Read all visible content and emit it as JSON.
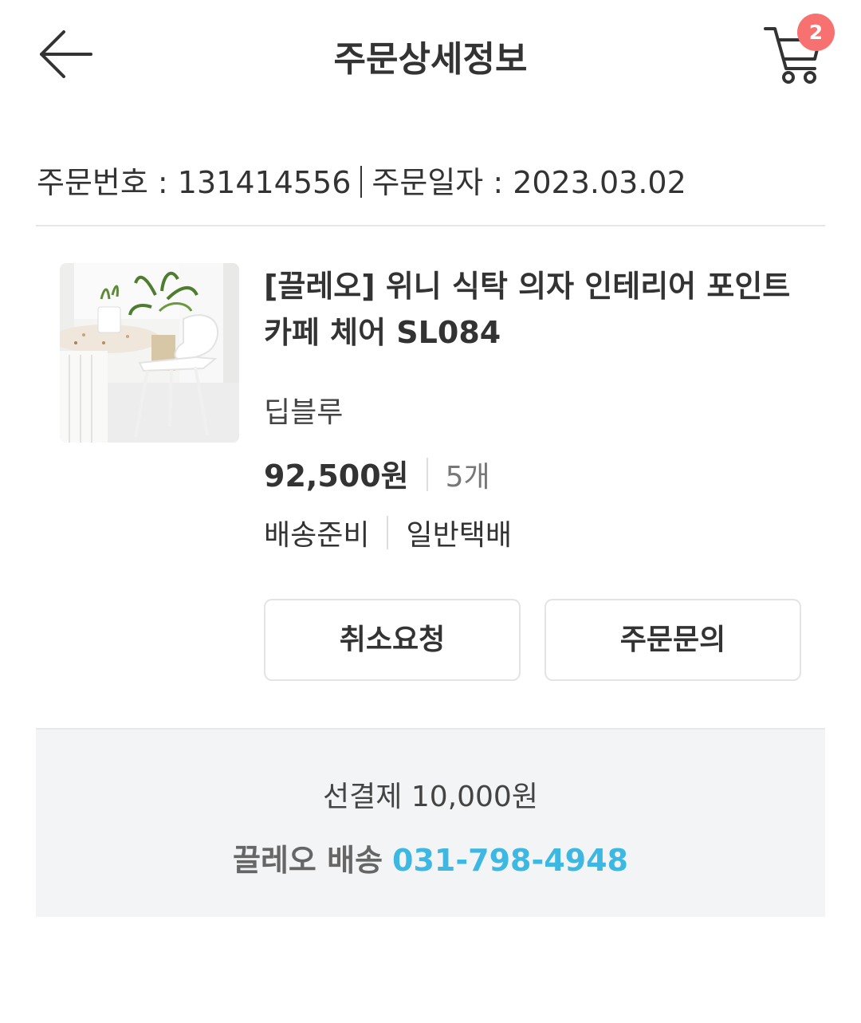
{
  "header": {
    "title": "주문상세정보",
    "cart_count": "2"
  },
  "order": {
    "number_text": "주문번호 : 131414556",
    "date_text": "주문일자 : 2023.03.02"
  },
  "item": {
    "name": "[끌레오] 위니 식탁 의자 인테리어 포인트 카페 체어 SL084",
    "option": "딥블루",
    "price": "92,500원",
    "quantity": "5개",
    "status": "배송준비",
    "shipping_method": "일반택배",
    "thumbnail_icon": "product-photo-chair-table-plants"
  },
  "actions": {
    "cancel_label": "취소요청",
    "inquiry_label": "주문문의"
  },
  "delivery_info": {
    "prepaid_text": "선결제 10,000원",
    "carrier_label": "끌레오 배송",
    "phone": "031-798-4948"
  },
  "colors": {
    "badge": "#f77171",
    "phone_link": "#3cb8e3",
    "info_bg": "#f2f4f6"
  }
}
